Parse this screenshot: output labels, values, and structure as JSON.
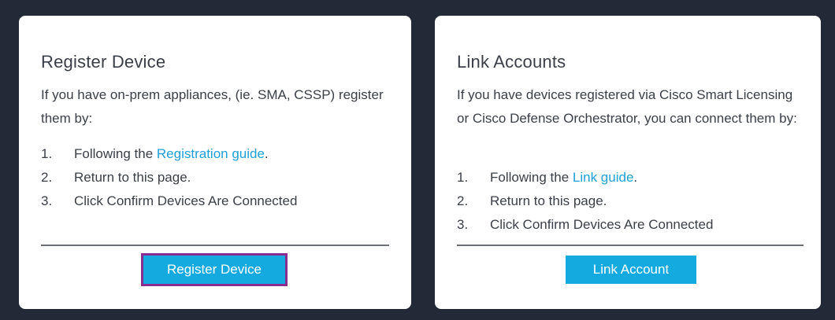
{
  "register_card": {
    "title": "Register Device",
    "description": "If you have on-prem appliances, (ie. SMA, CSSP) register them by:",
    "steps": [
      {
        "num": "1.",
        "prefix": "Following the ",
        "link": "Registration guide",
        "suffix": "."
      },
      {
        "num": "2.",
        "text": "Return to this page."
      },
      {
        "num": "3.",
        "text": "Click Confirm Devices Are Connected"
      }
    ],
    "button_label": "Register Device"
  },
  "link_card": {
    "title": "Link Accounts",
    "description": "If you have devices registered via Cisco Smart Licensing or Cisco Defense Orchestrator, you can connect them by:",
    "steps": [
      {
        "num": "1.",
        "prefix": "Following the ",
        "link": "Link guide",
        "suffix": "."
      },
      {
        "num": "2.",
        "text": "Return to this page."
      },
      {
        "num": "3.",
        "text": "Click Confirm Devices Are Connected"
      }
    ],
    "button_label": "Link Account"
  },
  "colors": {
    "background": "#232937",
    "card": "#ffffff",
    "text": "#3a3f47",
    "link": "#1e9fd8",
    "button": "#14a9df",
    "highlight_outline": "#8a2b8f"
  }
}
